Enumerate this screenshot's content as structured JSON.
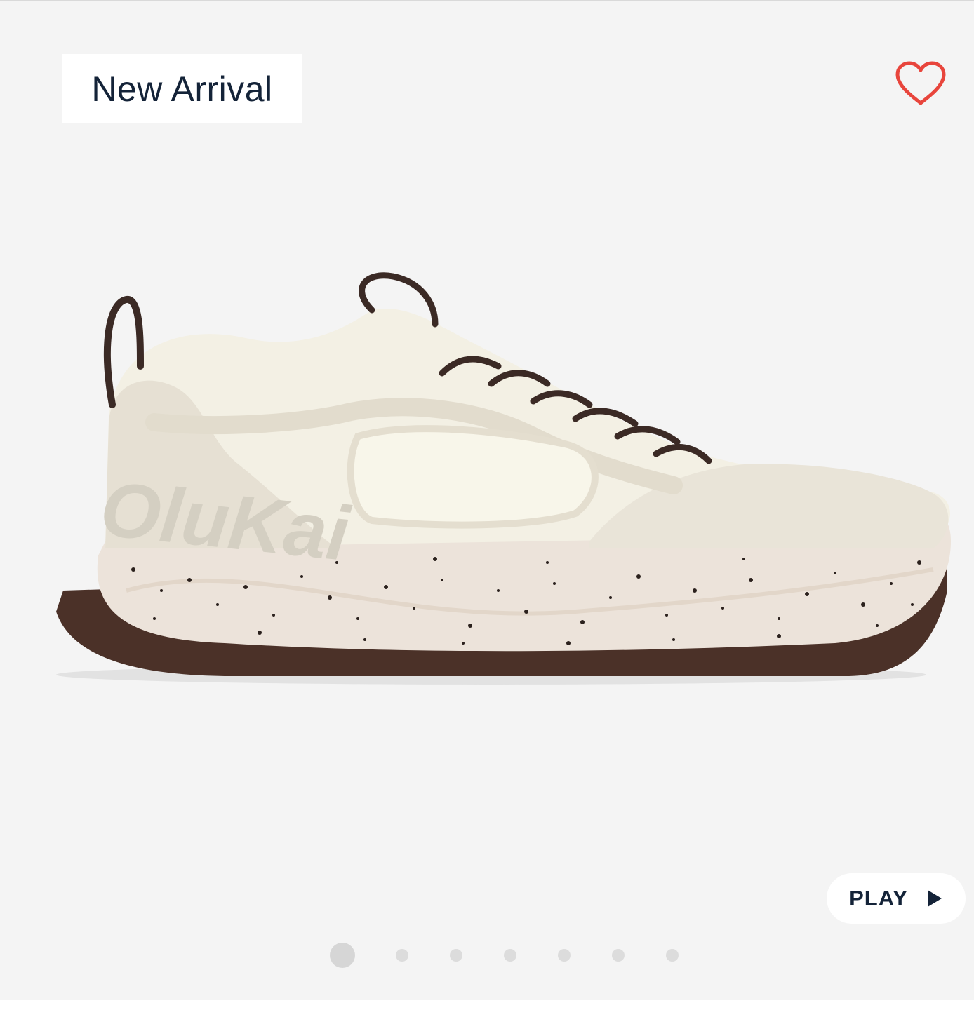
{
  "badge": {
    "label": "New Arrival"
  },
  "favorite": {
    "icon": "heart-outline-icon",
    "color": "#e8453c"
  },
  "product": {
    "image_icon": "sneaker-image",
    "brand_on_shoe": "OluKai"
  },
  "video": {
    "play_label": "PLAY",
    "icon": "play-triangle-icon"
  },
  "carousel": {
    "total": 7,
    "active_index": 0
  },
  "colors": {
    "background": "#f4f4f4",
    "text": "#142338",
    "accent": "#e8453c"
  }
}
